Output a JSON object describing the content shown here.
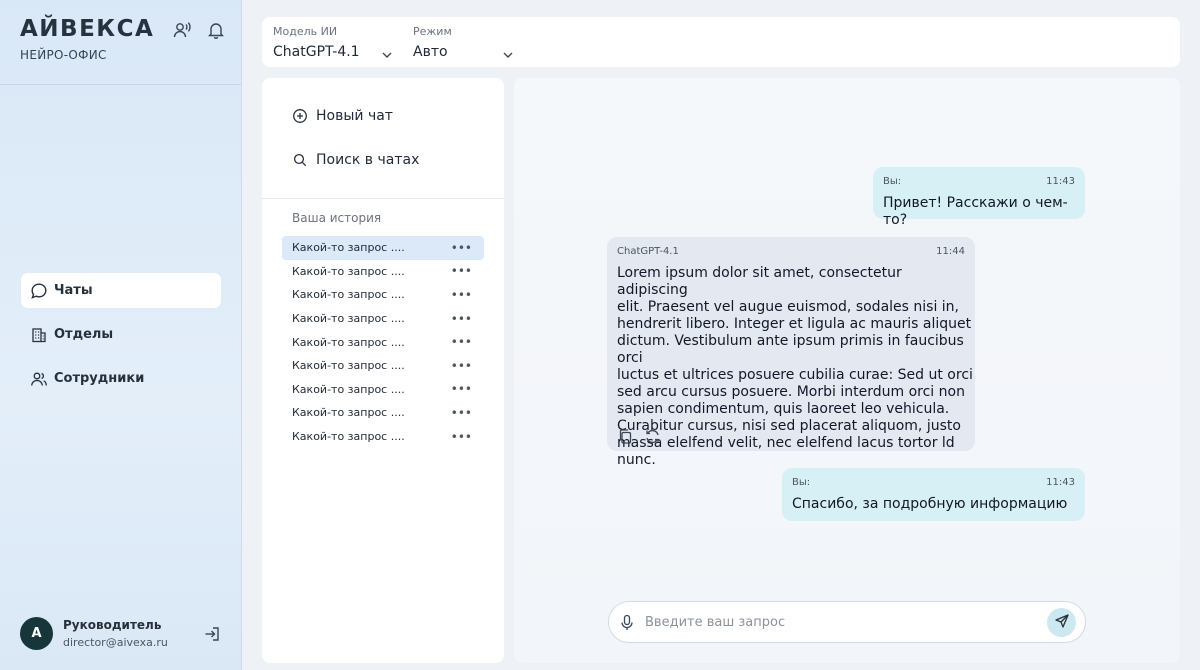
{
  "brand": {
    "logo": "АЙВЕКСА",
    "subtitle": "НЕЙРО-ОФИС"
  },
  "header_icons": [
    "voice-chat-icon",
    "bell-icon"
  ],
  "nav": {
    "items": [
      {
        "label": "Чаты",
        "icon": "chat-bubble-icon",
        "active": true
      },
      {
        "label": "Отделы",
        "icon": "building-icon",
        "active": false
      },
      {
        "label": "Сотрудники",
        "icon": "users-icon",
        "active": false
      }
    ]
  },
  "user": {
    "initial": "A",
    "name": "Руководитель",
    "email": "director@aivexa.ru"
  },
  "topbar": {
    "model": {
      "label": "Модель ИИ",
      "value": "ChatGPT-4.1"
    },
    "mode": {
      "label": "Режим",
      "value": "Авто"
    }
  },
  "history": {
    "new_chat": "Новый чат",
    "search": "Поиск в чатах",
    "title": "Ваша история",
    "items": [
      "Какой-то запрос ....",
      "Какой-то запрос ....",
      "Какой-то запрос ....",
      "Какой-то запрос ....",
      "Какой-то запрос ....",
      "Какой-то запрос ....",
      "Какой-то запрос ....",
      "Какой-то запрос ....",
      "Какой-то запрос ...."
    ],
    "more_label": "•••"
  },
  "messages": [
    {
      "role": "user",
      "author": "Вы:",
      "time": "11:43",
      "text": "Привет! Расскажи о чем-то?"
    },
    {
      "role": "bot",
      "author": "ChatGPT-4.1",
      "time": "11:44",
      "lines": [
        "Lorem ipsum dolor sit amet, consectetur adipiscing",
        "elit. Praesent vel augue euismod, sodales nisi in,",
        "hendrerit libero. Integer et ligula ac mauris aliquet",
        "dictum. Vestibulum ante ipsum primis in faucibus orci",
        "luctus et ultrices posuere cubilia curae: Sed ut orci",
        "sed arcu cursus posuere. Morbi interdum orci non",
        "sapien condimentum, quis laoreet leo vehicula.",
        "Curabitur cursus, nisi sed placerat aliquom, justo",
        "massa elelfend velit, nec elelfend lacus tortor ld nunc."
      ]
    },
    {
      "role": "user",
      "author": "Вы:",
      "time": "11:43",
      "text": "Спасибо, за подробную информацию"
    }
  ],
  "composer": {
    "placeholder": "Введите ваш запрос"
  },
  "colors": {
    "sidebar_bg": "#dbe9f7",
    "user_bubble": "#d7f0f5",
    "bot_bubble": "#e4e8f1",
    "active_history": "#dbe9f8",
    "avatar": "#16363a"
  }
}
